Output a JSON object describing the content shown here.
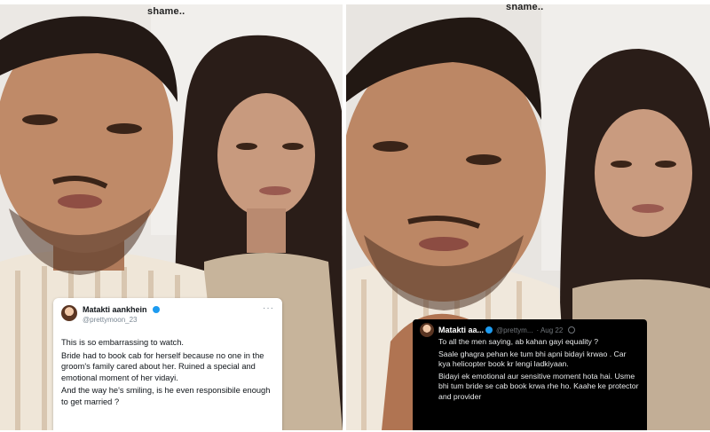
{
  "left_panel": {
    "top_caption": "shame..",
    "tweet": {
      "username": "Matakti aankhein",
      "handle": "@prettymoon_23",
      "more_label": "···",
      "paragraphs": [
        "This is so embarrassing to watch.",
        "Bride had to book cab for herself because no one in the groom's family cared about her. Ruined a special and emotional moment of her vidayi.",
        "And the way he's smiling, is he even responsibile enough to get married ?"
      ]
    }
  },
  "right_panel": {
    "top_caption": "shame..",
    "tweet": {
      "username": "Matakti aa...",
      "handle": "@prettym...",
      "date": "· Aug 22",
      "paragraphs": [
        "To all the men saying, ab kahan gayi equality ?",
        "Saale ghagra pehan ke tum bhi apni bidayi krwao . Car kya helicopter book kr lengi ladkiyaan.",
        "Bidayi ek emotional aur sensitive moment hota hai. Usme bhi tum bride se cab book krwa rhe ho. Kaahe ke protector and provider"
      ]
    }
  },
  "colors": {
    "twitter_blue": "#1d9bf0",
    "dark_card": "#000000",
    "light_card": "#ffffff"
  }
}
